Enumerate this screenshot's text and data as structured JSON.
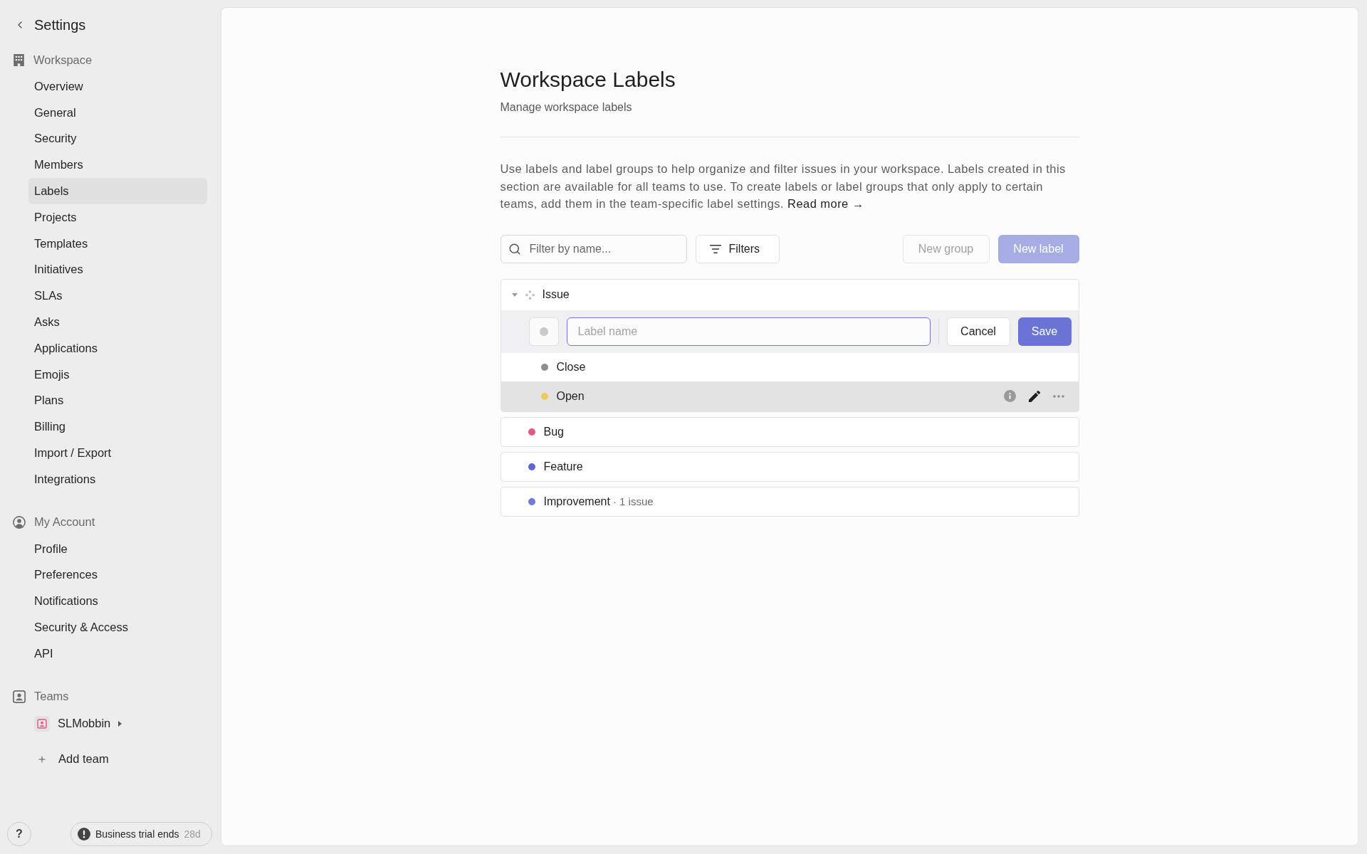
{
  "sidebar": {
    "back": "Settings",
    "sections": [
      {
        "kind": "workspace",
        "title": "Workspace",
        "items": [
          {
            "label": "Overview",
            "selected": false
          },
          {
            "label": "General",
            "selected": false
          },
          {
            "label": "Security",
            "selected": false
          },
          {
            "label": "Members",
            "selected": false
          },
          {
            "label": "Labels",
            "selected": true
          },
          {
            "label": "Projects",
            "selected": false
          },
          {
            "label": "Templates",
            "selected": false
          },
          {
            "label": "Initiatives",
            "selected": false
          },
          {
            "label": "SLAs",
            "selected": false
          },
          {
            "label": "Asks",
            "selected": false
          },
          {
            "label": "Applications",
            "selected": false
          },
          {
            "label": "Emojis",
            "selected": false
          },
          {
            "label": "Plans",
            "selected": false
          },
          {
            "label": "Billing",
            "selected": false
          },
          {
            "label": "Import / Export",
            "selected": false
          },
          {
            "label": "Integrations",
            "selected": false
          }
        ]
      },
      {
        "kind": "account",
        "title": "My Account",
        "items": [
          {
            "label": "Profile",
            "selected": false
          },
          {
            "label": "Preferences",
            "selected": false
          },
          {
            "label": "Notifications",
            "selected": false
          },
          {
            "label": "Security & Access",
            "selected": false
          },
          {
            "label": "API",
            "selected": false
          }
        ]
      },
      {
        "kind": "teams",
        "title": "Teams",
        "teams": [
          {
            "name": "SLMobbin",
            "expanded": false
          }
        ],
        "add_team": "Add team"
      }
    ]
  },
  "footer": {
    "help": "?",
    "trial": {
      "label": "Business trial ends",
      "days": "28d"
    }
  },
  "page": {
    "title": "Workspace Labels",
    "subtitle": "Manage workspace labels",
    "description": "Use labels and label groups to help organize and filter issues in your workspace. Labels created in this section are available for all teams to use. To create labels or label groups that only apply to certain teams, add them in the team-specific label settings.",
    "read_more": "Read more →"
  },
  "toolbar": {
    "search": {
      "placeholder": "Filter by name..."
    },
    "filters": "Filters",
    "new_group": {
      "label": "New group",
      "disabled": true
    },
    "new_label": {
      "label": "New label",
      "disabled": true
    }
  },
  "labels": [
    {
      "kind": "group",
      "name": "Issue",
      "expanded": true,
      "editor": {
        "placeholder": "Label name",
        "focused": true,
        "cancel": "Cancel",
        "save": "Save"
      },
      "children": [
        {
          "name": "Close",
          "color": "#8e8e8e",
          "hovered": false
        },
        {
          "name": "Open",
          "color": "#f0c95c",
          "hovered": true
        }
      ]
    },
    {
      "kind": "label",
      "name": "Bug",
      "color": "#e05a86"
    },
    {
      "kind": "label",
      "name": "Feature",
      "color": "#5e68cf"
    },
    {
      "kind": "label",
      "name": "Improvement",
      "color": "#717bd8",
      "usage": "· 1 issue"
    }
  ]
}
